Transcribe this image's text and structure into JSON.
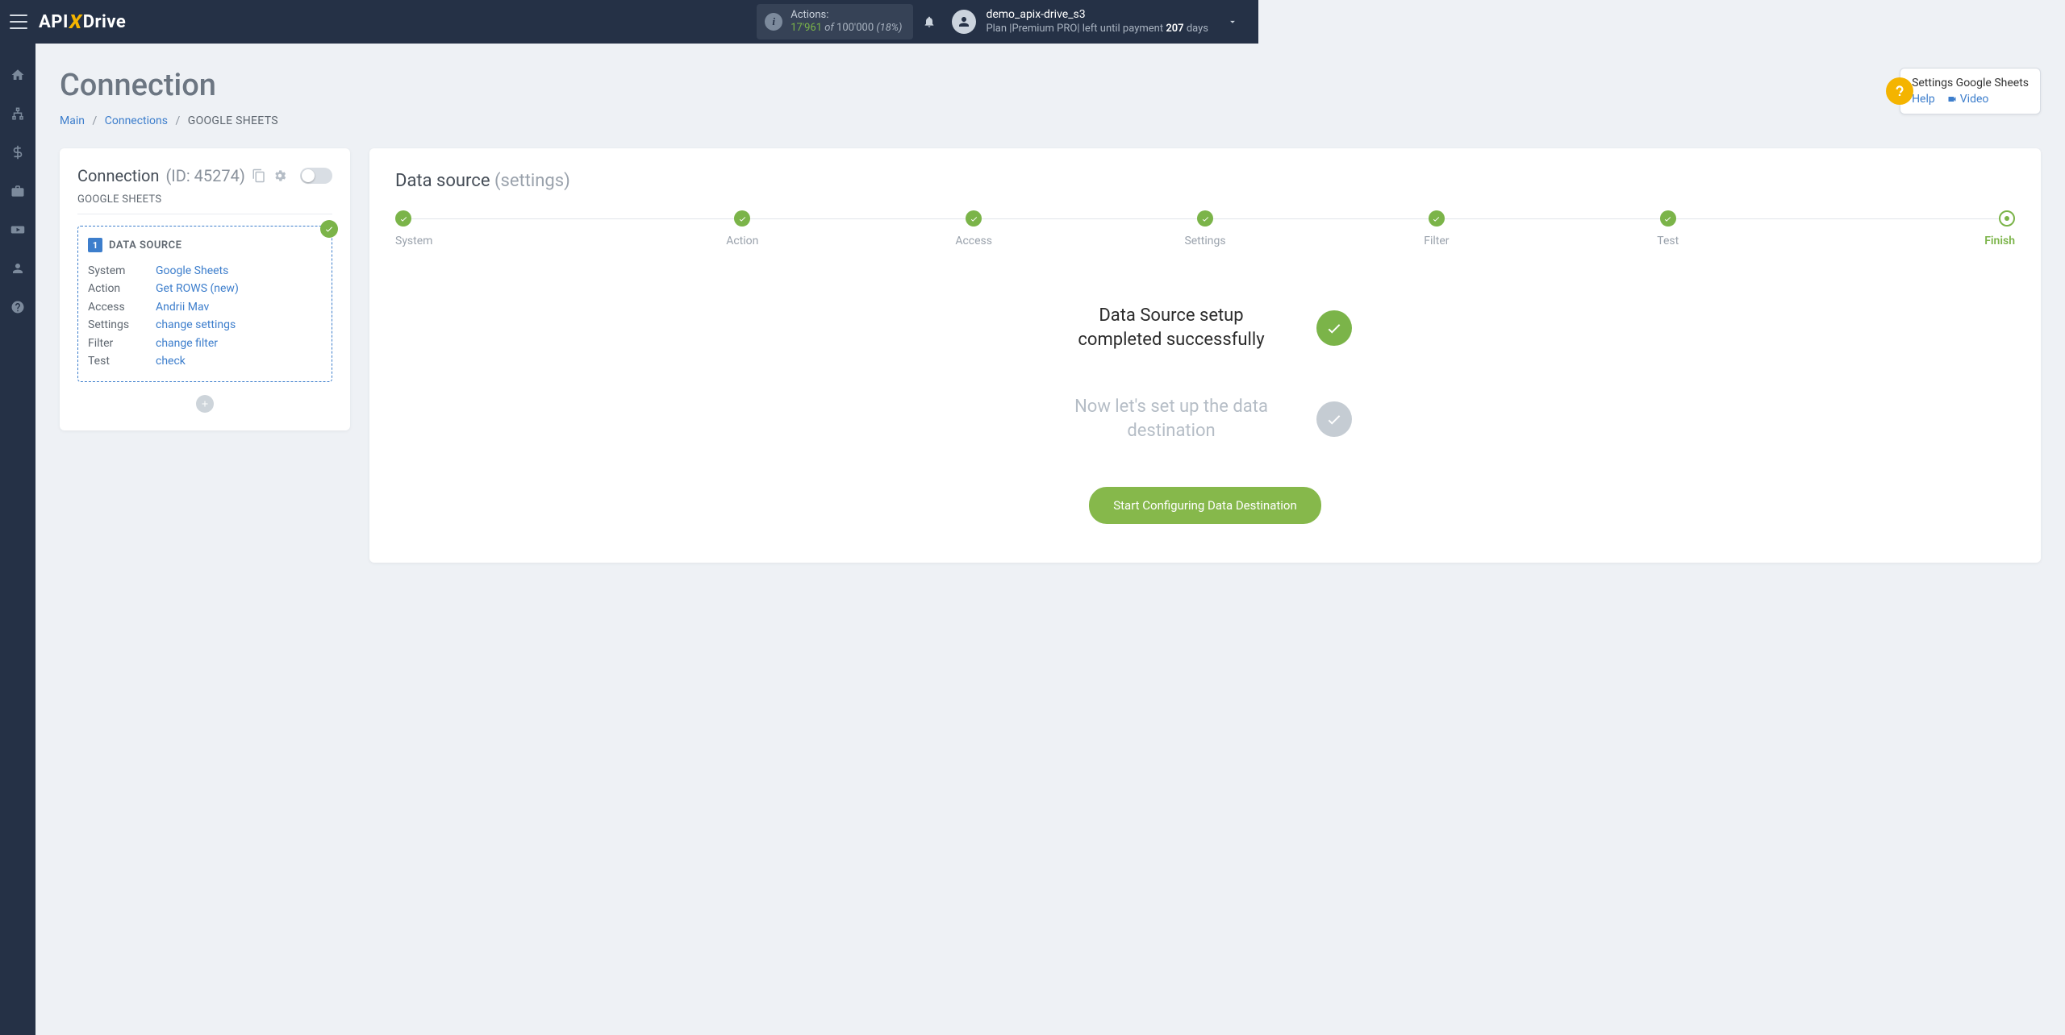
{
  "brand": {
    "api": "API",
    "x": "X",
    "drive": "Drive"
  },
  "header": {
    "actions_label": "Actions:",
    "actions_used": "17'961",
    "actions_of": " of ",
    "actions_total": "100'000",
    "actions_pct": " (18%)",
    "username": "demo_apix-drive_s3",
    "plan_prefix": "Plan |Premium PRO| left until payment ",
    "plan_days": "207",
    "plan_suffix": " days"
  },
  "page": {
    "title": "Connection",
    "breadcrumb": {
      "main": "Main",
      "connections": "Connections",
      "current": "GOOGLE SHEETS"
    }
  },
  "helpbox": {
    "title": "Settings Google Sheets",
    "help": "Help",
    "video": "Video"
  },
  "left": {
    "title": "Connection ",
    "id": "(ID: 45274)",
    "service": "GOOGLE SHEETS",
    "ds_num": "1",
    "ds_title": "DATA SOURCE",
    "rows": [
      {
        "k": "System",
        "v": "Google Sheets"
      },
      {
        "k": "Action",
        "v": "Get ROWS (new)"
      },
      {
        "k": "Access",
        "v": "Andrii Mav"
      },
      {
        "k": "Settings",
        "v": "change settings"
      },
      {
        "k": "Filter",
        "v": "change filter"
      },
      {
        "k": "Test",
        "v": "check"
      }
    ]
  },
  "right": {
    "title": "Data source ",
    "title_sub": "(settings)",
    "steps": [
      "System",
      "Action",
      "Access",
      "Settings",
      "Filter",
      "Test",
      "Finish"
    ],
    "msg1": "Data Source setup completed successfully",
    "msg2": "Now let's set up the data destination",
    "cta": "Start Configuring Data Destination"
  }
}
